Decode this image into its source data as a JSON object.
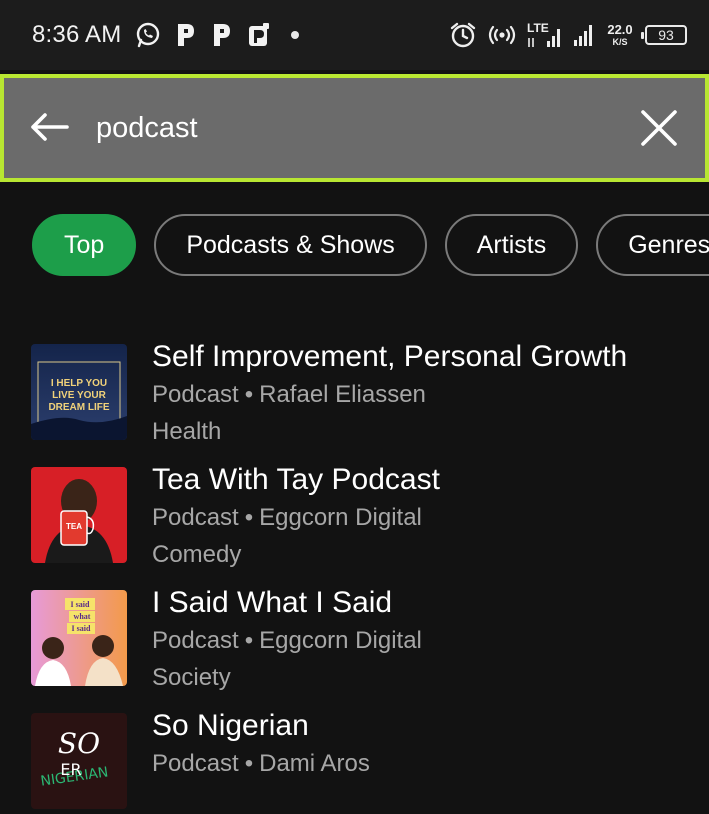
{
  "status_bar": {
    "time": "8:36 AM",
    "notif_icons": [
      "whatsapp-icon",
      "p-app-icon",
      "p-app-icon",
      "p-app-icon"
    ],
    "lte_label": "LTE",
    "net_speed_value": "22.0",
    "net_speed_unit": "K/S",
    "battery_level": "93"
  },
  "search": {
    "query": "podcast",
    "accent_color": "#b8e632"
  },
  "filters": {
    "chips": [
      {
        "label": "Top",
        "active": true
      },
      {
        "label": "Podcasts & Shows",
        "active": false
      },
      {
        "label": "Artists",
        "active": false
      },
      {
        "label": "Genres",
        "active": false
      }
    ],
    "active_color": "#1d9e4a"
  },
  "results": [
    {
      "title": "Self Improvement, Personal Growth",
      "type": "Podcast",
      "author": "Rafael Eliassen",
      "genre": "Health",
      "cover_text": "I HELP YOU LIVE YOUR DREAM LIFE"
    },
    {
      "title": "Tea With Tay Podcast",
      "type": "Podcast",
      "author": "Eggcorn Digital",
      "genre": "Comedy",
      "cover_text": "TEA"
    },
    {
      "title": "I Said What I Said",
      "type": "Podcast",
      "author": "Eggcorn Digital",
      "genre": "Society",
      "cover_text": "I said what I said"
    },
    {
      "title": "So Nigerian",
      "type": "Podcast",
      "author": "Dami Aros",
      "genre": "",
      "cover_text": "SO NIGERIAN"
    }
  ]
}
